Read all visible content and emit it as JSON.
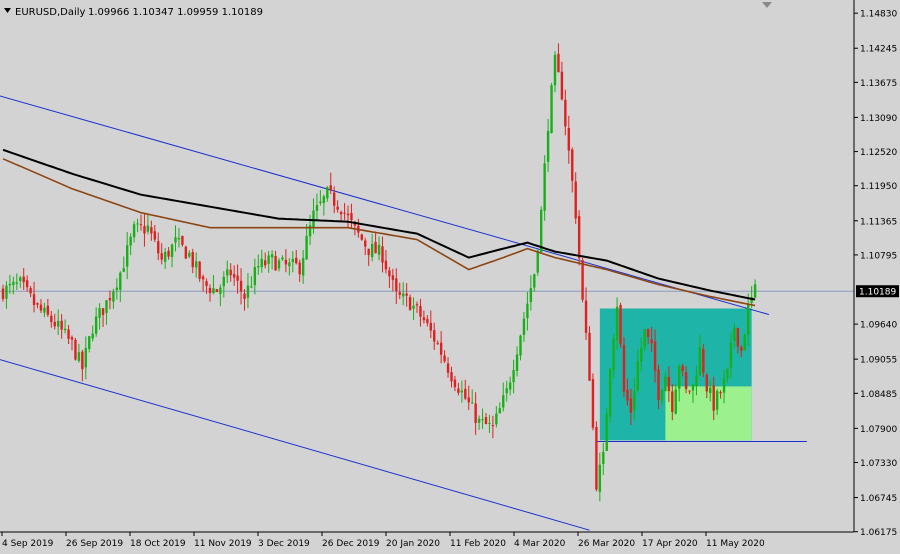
{
  "header": {
    "symbol": "EURUSD,Daily",
    "ohlc": "1.09966 1.10347 1.09959 1.10189"
  },
  "colors": {
    "background": "#d3d3d3",
    "bull_candle": "#18b018",
    "bear_candle": "#e02020",
    "ma_fast": "#000000",
    "ma_slow": "#8b4513",
    "channel": "#1a2fd0",
    "zone_dark": "#1eb4a8",
    "zone_light": "#9df08e",
    "current_price_line": "#8a9bc0",
    "price_tag_bg": "#000000"
  },
  "chart_data": {
    "type": "candlestick",
    "symbol": "EURUSD",
    "timeframe": "Daily",
    "ylim": [
      1.0617,
      1.1505
    ],
    "y_ticks": [
      "1.14830",
      "1.14245",
      "1.13675",
      "1.13090",
      "1.12520",
      "1.11950",
      "1.11365",
      "1.10795",
      "1.10189",
      "1.09640",
      "1.09055",
      "1.08485",
      "1.07900",
      "1.07330",
      "1.06745",
      "1.06175"
    ],
    "x_ticks": [
      "4 Sep 2019",
      "26 Sep 2019",
      "18 Oct 2019",
      "11 Nov 2019",
      "3 Dec 2019",
      "26 Dec 2019",
      "20 Jan 2020",
      "11 Feb 2020",
      "4 Mar 2020",
      "26 Mar 2020",
      "17 Apr 2020",
      "11 May 2020"
    ],
    "current_price": "1.10189",
    "close_path": [
      [
        0,
        1.102
      ],
      [
        5,
        1.103
      ],
      [
        10,
        1.099
      ],
      [
        15,
        1.0965
      ],
      [
        20,
        1.093
      ],
      [
        23,
        1.089
      ],
      [
        26,
        1.096
      ],
      [
        30,
        1.1
      ],
      [
        34,
        1.105
      ],
      [
        38,
        1.112
      ],
      [
        42,
        1.1125
      ],
      [
        46,
        1.107
      ],
      [
        50,
        1.11
      ],
      [
        54,
        1.108
      ],
      [
        58,
        1.103
      ],
      [
        62,
        1.102
      ],
      [
        66,
        1.105
      ],
      [
        70,
        1.101
      ],
      [
        74,
        1.106
      ],
      [
        78,
        1.107
      ],
      [
        82,
        1.106
      ],
      [
        86,
        1.106
      ],
      [
        90,
        1.1145
      ],
      [
        94,
        1.118
      ],
      [
        98,
        1.116
      ],
      [
        102,
        1.112
      ],
      [
        106,
        1.109
      ],
      [
        110,
        1.108
      ],
      [
        114,
        1.101
      ],
      [
        118,
        1.1
      ],
      [
        122,
        1.097
      ],
      [
        126,
        1.093
      ],
      [
        130,
        1.088
      ],
      [
        134,
        1.084
      ],
      [
        138,
        1.08
      ],
      [
        142,
        1.079
      ],
      [
        146,
        1.085
      ],
      [
        150,
        1.095
      ],
      [
        154,
        1.105
      ],
      [
        156,
        1.115
      ],
      [
        158,
        1.13
      ],
      [
        160,
        1.14
      ],
      [
        162,
        1.135
      ],
      [
        164,
        1.125
      ],
      [
        166,
        1.115
      ],
      [
        168,
        1.1
      ],
      [
        170,
        1.088
      ],
      [
        172,
        1.07
      ],
      [
        174,
        1.074
      ],
      [
        176,
        1.09
      ],
      [
        178,
        1.1
      ],
      [
        180,
        1.085
      ],
      [
        182,
        1.082
      ],
      [
        184,
        1.09
      ],
      [
        186,
        1.095
      ],
      [
        188,
        1.092
      ],
      [
        190,
        1.085
      ],
      [
        192,
        1.088
      ],
      [
        194,
        1.083
      ],
      [
        196,
        1.09
      ],
      [
        198,
        1.085
      ],
      [
        200,
        1.086
      ],
      [
        202,
        1.092
      ],
      [
        204,
        1.086
      ],
      [
        206,
        1.083
      ],
      [
        208,
        1.085
      ],
      [
        210,
        1.088
      ],
      [
        212,
        1.096
      ],
      [
        214,
        1.092
      ],
      [
        216,
        1.099
      ],
      [
        218,
        1.1019
      ]
    ],
    "ma_fast": [
      [
        0,
        1.1255
      ],
      [
        20,
        1.1215
      ],
      [
        40,
        1.118
      ],
      [
        60,
        1.116
      ],
      [
        80,
        1.114
      ],
      [
        100,
        1.1135
      ],
      [
        120,
        1.1115
      ],
      [
        135,
        1.1075
      ],
      [
        145,
        1.109
      ],
      [
        152,
        1.11
      ],
      [
        160,
        1.1085
      ],
      [
        175,
        1.107
      ],
      [
        190,
        1.104
      ],
      [
        205,
        1.102
      ],
      [
        218,
        1.1005
      ]
    ],
    "ma_slow": [
      [
        0,
        1.124
      ],
      [
        20,
        1.119
      ],
      [
        40,
        1.115
      ],
      [
        60,
        1.1125
      ],
      [
        80,
        1.1125
      ],
      [
        100,
        1.1125
      ],
      [
        120,
        1.1105
      ],
      [
        135,
        1.1055
      ],
      [
        145,
        1.1075
      ],
      [
        152,
        1.109
      ],
      [
        160,
        1.1075
      ],
      [
        175,
        1.1055
      ],
      [
        190,
        1.103
      ],
      [
        205,
        1.101
      ],
      [
        218,
        1.0995
      ]
    ],
    "channel_upper": [
      [
        -1,
        1.1345
      ],
      [
        222,
        1.098
      ]
    ],
    "channel_lower": [
      [
        -1,
        1.0905
      ],
      [
        170,
        1.062
      ]
    ],
    "support_line": {
      "from": 172,
      "to": 233,
      "price": 1.0768
    },
    "zones": [
      {
        "from": 173,
        "to": 217,
        "top": 1.099,
        "bottom": 1.077,
        "color": "dark"
      },
      {
        "from": 192,
        "to": 217,
        "top": 1.086,
        "bottom": 1.077,
        "color": "light"
      }
    ],
    "n_bars": 219
  }
}
